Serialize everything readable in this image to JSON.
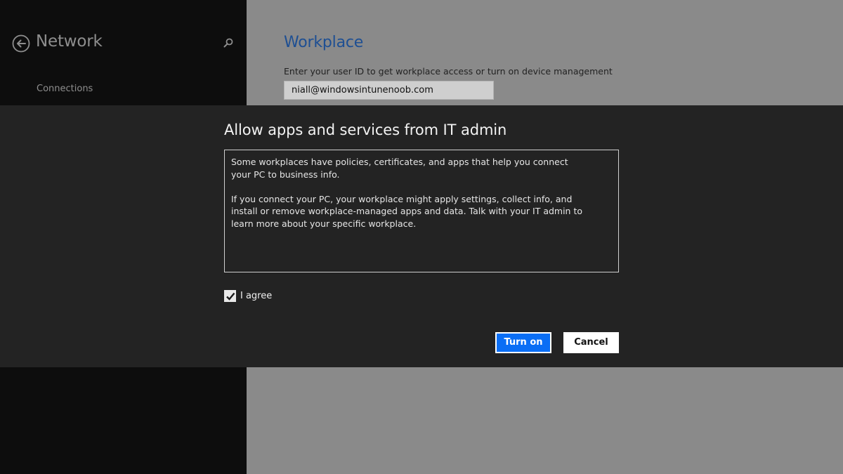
{
  "sidebar": {
    "title": "Network",
    "items": [
      {
        "label": "Connections"
      }
    ]
  },
  "content": {
    "title": "Workplace",
    "description": "Enter your user ID to get workplace access or turn on device management",
    "user_id_value": "niall@windowsintunenoob.com"
  },
  "dialog": {
    "title": "Allow apps and services from IT admin",
    "paragraphs": [
      "Some workplaces have policies, certificates, and apps that help you connect your PC to business info.",
      "If you connect your PC, your workplace might apply settings, collect info, and install or remove workplace-managed apps and data. Talk with your IT admin to learn more about your specific workplace."
    ],
    "agree_label": "I agree",
    "agree_checked": true,
    "primary_button": "Turn on",
    "secondary_button": "Cancel"
  },
  "colors": {
    "sidebar_bg": "#0d0d0d",
    "content_bg": "#8a8a8a",
    "dialog_bg": "#232323",
    "accent_title": "#1e4f93",
    "primary_button": "#0a6ef5"
  },
  "icons": {
    "back": "back-arrow-circle-icon",
    "search": "search-icon",
    "check": "checkmark-icon"
  }
}
